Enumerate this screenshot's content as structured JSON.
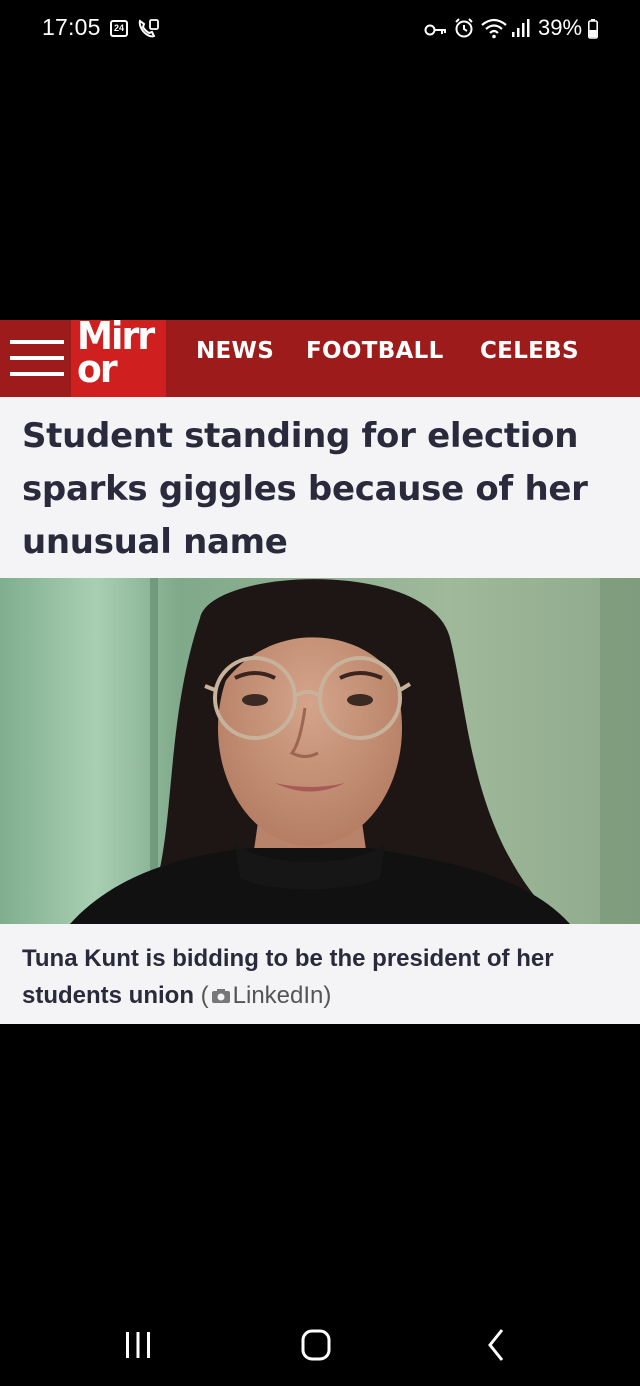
{
  "status_bar": {
    "time": "17:05",
    "calendar_day": "24",
    "battery": "39%"
  },
  "article": {
    "logo": "Mirror",
    "nav": [
      "NEWS",
      "FOOTBALL",
      "CELEBS"
    ],
    "headline": "Student standing for election sparks giggles because of her unusual name",
    "caption": "Tuna Kunt is bidding to be the president of her students union",
    "credit_open": "(",
    "credit_source": "LinkedIn",
    "credit_close": ")",
    "colors": {
      "masthead": "#9e1b1b",
      "logo_bg": "#cf1f1f",
      "panel_bg": "#f4f4f6",
      "headline_text": "#2a2a3c"
    }
  },
  "system_nav": {
    "recents_icon": "recents-icon",
    "home_icon": "home-icon",
    "back_icon": "back-icon"
  }
}
